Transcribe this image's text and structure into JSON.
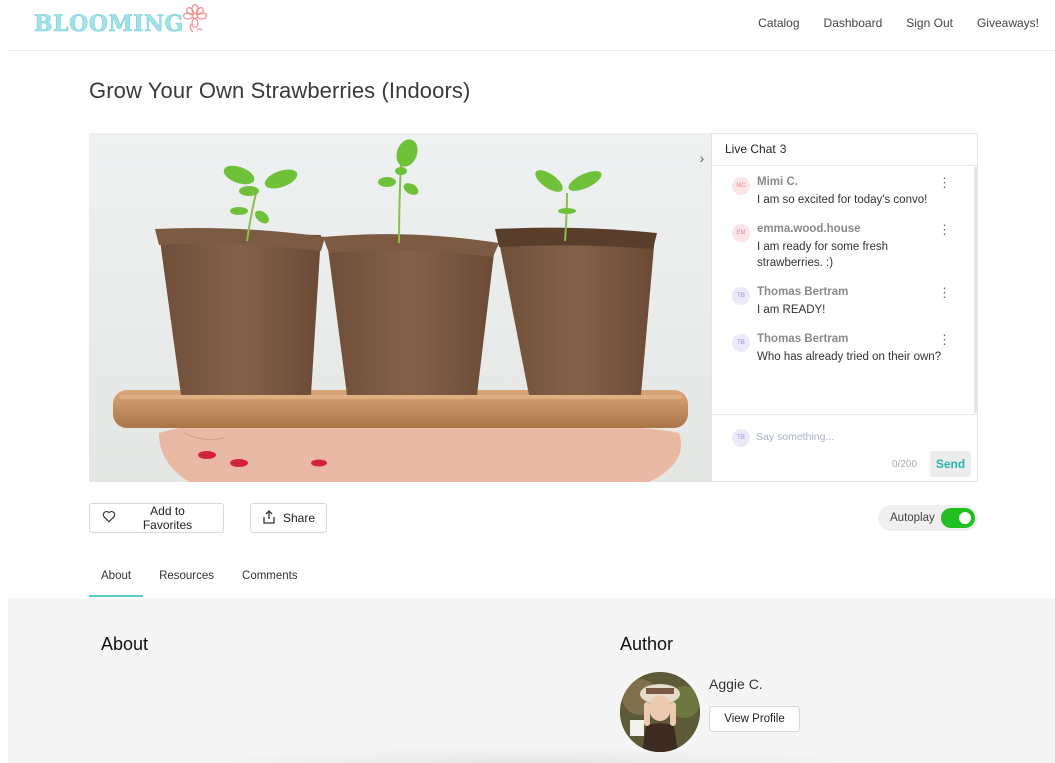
{
  "brand": {
    "name": "BLOOMING",
    "logo_icon": "flower-icon"
  },
  "nav": {
    "items": [
      {
        "label": "Catalog"
      },
      {
        "label": "Dashboard"
      },
      {
        "label": "Sign Out"
      },
      {
        "label": "Giveaways!"
      }
    ]
  },
  "page": {
    "title": "Grow Your Own Strawberries (Indoors)"
  },
  "video": {
    "description": "Three peat pots with seedlings on a wooden tray held by a hand",
    "collapse_chat_icon": "chevron-right-icon"
  },
  "chat": {
    "title": "Live Chat",
    "count": "3",
    "messages": [
      {
        "initials": "MC",
        "name": "Mimi C.",
        "text": "I am so excited for today's convo!",
        "avatar_bg": "#fde4e6",
        "avatar_fg": "#f08a94"
      },
      {
        "initials": "EM",
        "name": "emma.wood.house",
        "text": "I am ready for some fresh strawberries. :)",
        "avatar_bg": "#fde4e6",
        "avatar_fg": "#f08a94"
      },
      {
        "initials": "TB",
        "name": "Thomas Bertram",
        "text": "I am READY!",
        "avatar_bg": "#ece9fb",
        "avatar_fg": "#9a90e0"
      },
      {
        "initials": "TB",
        "name": "Thomas Bertram",
        "text": "Who has already tried on their own?",
        "avatar_bg": "#ece9fb",
        "avatar_fg": "#9a90e0"
      }
    ],
    "input": {
      "avatar_initials": "TB",
      "placeholder": "Say something...",
      "value": "",
      "char_count": "0/200",
      "send_label": "Send"
    }
  },
  "actions": {
    "favorite_label": "Add to Favorites",
    "share_label": "Share",
    "autoplay_label": "Autoplay",
    "autoplay_on": true
  },
  "tabs": [
    {
      "label": "About",
      "active": true
    },
    {
      "label": "Resources",
      "active": false
    },
    {
      "label": "Comments",
      "active": false
    }
  ],
  "about": {
    "heading": "About"
  },
  "author": {
    "heading": "Author",
    "name": "Aggie C.",
    "profile_button": "View Profile"
  },
  "colors": {
    "brand_teal": "#9fe3ea",
    "brand_pink": "#f2908f",
    "accent_teal": "#2bb3ad",
    "tab_underline": "#5cc9cc",
    "toggle_on": "#20c020"
  }
}
